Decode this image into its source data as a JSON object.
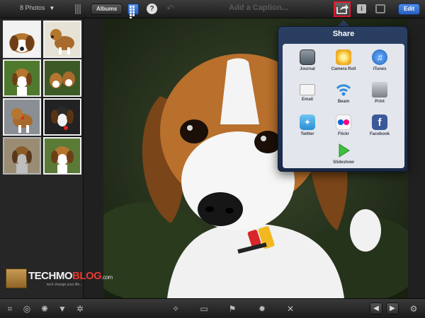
{
  "topbar": {
    "photos_count": "8 Photos",
    "albums_label": "Albums",
    "help_label": "?",
    "caption_placeholder": "Add a Caption...",
    "info_label": "i",
    "edit_label": "Edit"
  },
  "sidebar": {
    "thumbnails": [
      {
        "name": "beagle-puppy-closeup"
      },
      {
        "name": "beagle-puppy-standing"
      },
      {
        "name": "beagle-on-grass"
      },
      {
        "name": "two-beagle-puppies"
      },
      {
        "name": "beagle-with-tag"
      },
      {
        "name": "beagle-selected"
      },
      {
        "name": "beagle-puppy-sitting"
      },
      {
        "name": "beagle-puppy-lying"
      }
    ]
  },
  "watermark": {
    "brand_prefix": "TECHMO",
    "brand_suffix": "BLOG",
    "domain": ".com",
    "tagline": "tech change your life..."
  },
  "share_popover": {
    "title": "Share",
    "items": [
      {
        "label": "Journal",
        "icon": "journal-icon",
        "color": "#6b7a86"
      },
      {
        "label": "Camera Roll",
        "icon": "camera-roll-icon",
        "color": "#f2b627"
      },
      {
        "label": "iTunes",
        "icon": "itunes-icon",
        "color": "#2a76d2"
      },
      {
        "label": "Email",
        "icon": "email-icon",
        "color": "#e8e8e8"
      },
      {
        "label": "Beam",
        "icon": "beam-icon",
        "color": "#2f8be0"
      },
      {
        "label": "Print",
        "icon": "print-icon",
        "color": "#8a8f98"
      },
      {
        "label": "Twitter",
        "icon": "twitter-icon",
        "color": "#3fa6e6"
      },
      {
        "label": "Flickr",
        "icon": "flickr-icon",
        "color": "#f4f4f4"
      },
      {
        "label": "Facebook",
        "icon": "facebook-icon",
        "color": "#3b5998"
      },
      {
        "label": "Slideshow",
        "icon": "slideshow-icon",
        "color": "#3fbf3f"
      }
    ]
  },
  "bottombar": {
    "tools": [
      "crop-icon",
      "straighten-icon",
      "exposure-icon",
      "color-icon",
      "brushes-icon",
      "effects-icon"
    ],
    "center_tools": [
      "magic-wand-icon",
      "compare-icon",
      "flag-icon",
      "heart-icon",
      "reject-icon"
    ]
  },
  "colors": {
    "accent_blue": "#2a5fc0",
    "share_highlight": "#e0192a",
    "popover_bg": "#2b3f63"
  }
}
